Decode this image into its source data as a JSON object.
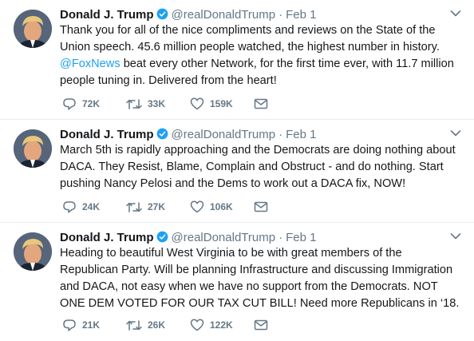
{
  "tweets": [
    {
      "name": "Donald J. Trump",
      "handle": "@realDonaldTrump",
      "separator": "·",
      "date": "Feb 1",
      "text_before": "Thank you for all of the nice compliments and reviews on the State of the Union speech. 45.6 million people watched, the highest number in history. ",
      "mention": "@FoxNews",
      "text_after": " beat every other Network, for the first time ever, with 11.7 million people tuning in. Delivered from the heart!",
      "replies": "72K",
      "retweets": "33K",
      "likes": "159K"
    },
    {
      "name": "Donald J. Trump",
      "handle": "@realDonaldTrump",
      "separator": "·",
      "date": "Feb 1",
      "text": "March 5th is rapidly approaching and the Democrats are doing nothing about DACA. They Resist, Blame, Complain and Obstruct - and do nothing. Start pushing Nancy Pelosi and the Dems to work out a DACA fix, NOW!",
      "replies": "24K",
      "retweets": "27K",
      "likes": "106K"
    },
    {
      "name": "Donald J. Trump",
      "handle": "@realDonaldTrump",
      "separator": "·",
      "date": "Feb 1",
      "text": "Heading to beautiful West Virginia to be with great members of the Republican Party. Will be planning Infrastructure and discussing Immigration and DACA, not easy when we have no support from the Democrats. NOT ONE DEM VOTED FOR OUR TAX CUT BILL! Need more Republicans in ‘18.",
      "replies": "21K",
      "retweets": "26K",
      "likes": "122K"
    }
  ],
  "icons": {
    "verified": "verified-badge-icon",
    "menu": "chevron-down-icon",
    "reply": "reply-icon",
    "retweet": "retweet-icon",
    "like": "heart-icon",
    "dm": "envelope-icon"
  },
  "colors": {
    "text": "#14171a",
    "muted": "#657786",
    "link": "#1da1f2",
    "verified": "#1da1f2",
    "divider": "#e6ecf0"
  }
}
